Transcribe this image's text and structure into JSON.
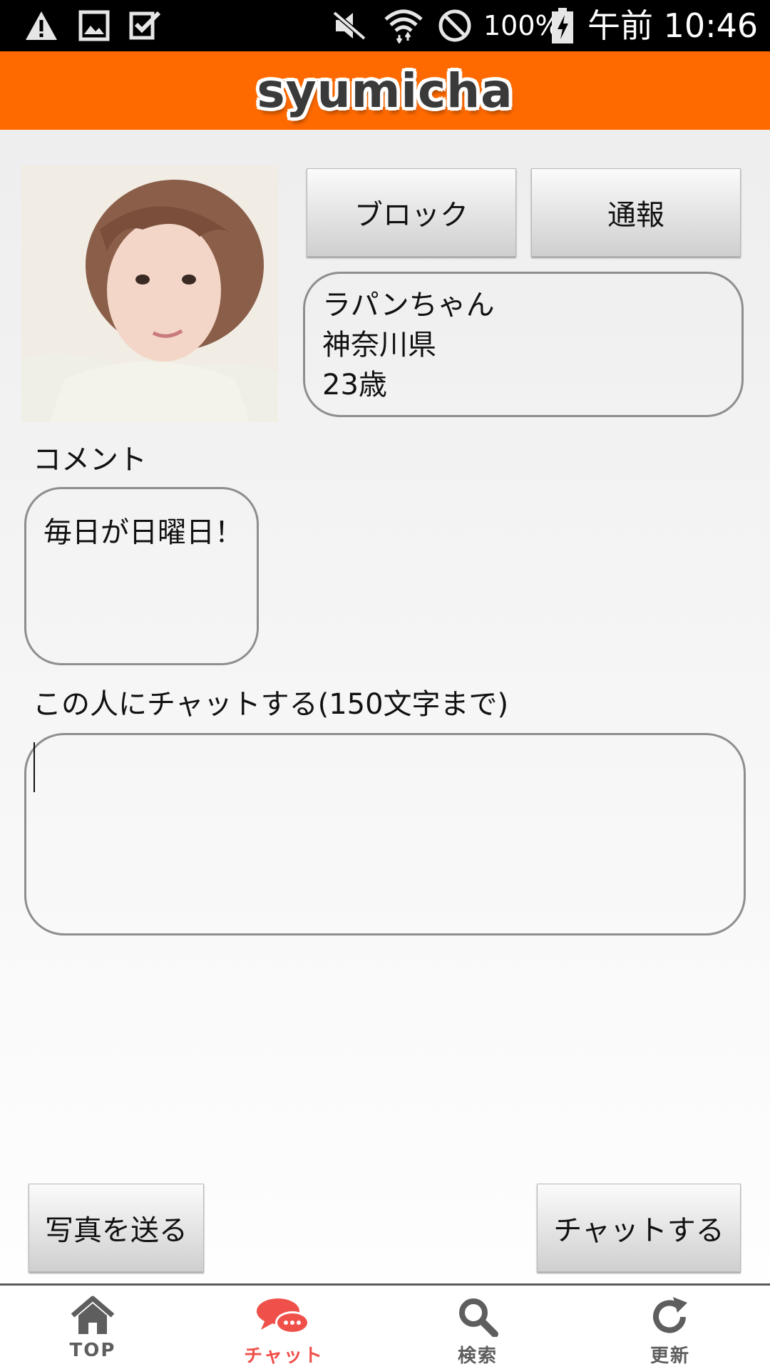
{
  "statusbar": {
    "battery": "100%",
    "time": "午前 10:46",
    "icons": [
      "warning-icon",
      "image-icon",
      "checkbox-icon",
      "vibrate-off-icon",
      "wifi-icon",
      "do-not-disturb-icon",
      "battery-charging-icon"
    ]
  },
  "header": {
    "logo": "syumicha",
    "color": "#ff6a00"
  },
  "profile": {
    "photo_icon": "profile-photo",
    "block_label": "ブロック",
    "report_label": "通報",
    "name": "ラパンちゃん",
    "prefecture": "神奈川県",
    "age": "23歳"
  },
  "comment": {
    "heading": "コメント",
    "text": "毎日が日曜日！"
  },
  "chat": {
    "heading": "この人にチャットする(150文字まで)",
    "value": "",
    "send_photo_label": "写真を送る",
    "send_chat_label": "チャットする"
  },
  "nav": {
    "items": [
      {
        "label": "TOP",
        "icon": "home-icon",
        "active": false
      },
      {
        "label": "チャット",
        "icon": "chat-bubbles-icon",
        "active": true
      },
      {
        "label": "検索",
        "icon": "search-icon",
        "active": false
      },
      {
        "label": "更新",
        "icon": "refresh-icon",
        "active": false
      }
    ],
    "active_color": "#f0504a",
    "inactive_color": "#5e5e5e"
  }
}
